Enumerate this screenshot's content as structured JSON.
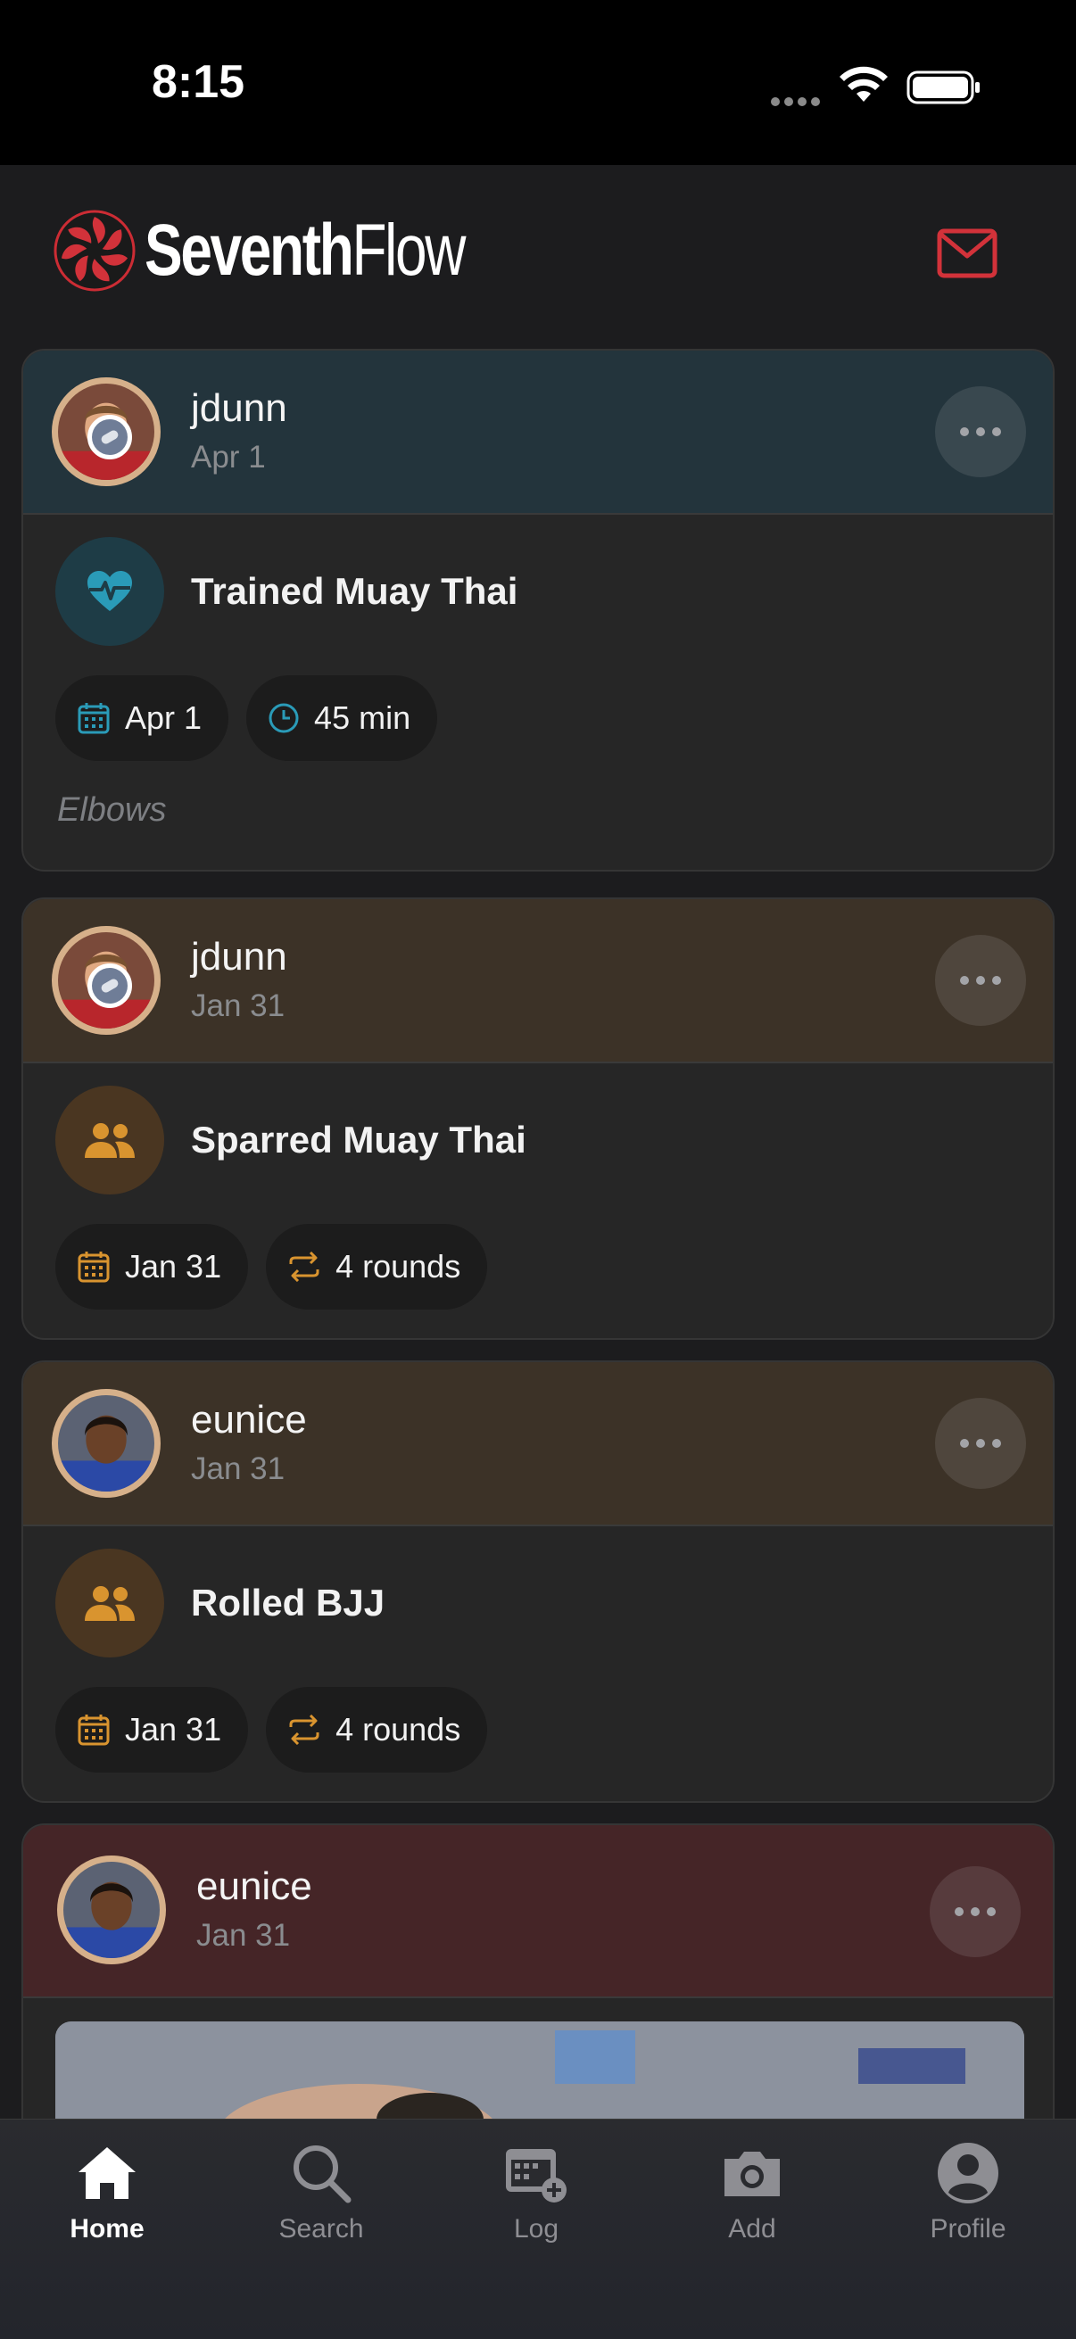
{
  "status_bar": {
    "time": "8:15"
  },
  "header": {
    "logo_bold": "Seventh",
    "logo_light": "Flow",
    "accent_color": "#d2323a"
  },
  "feed": [
    {
      "theme": "blue",
      "user": "jdunn",
      "date": "Apr 1",
      "has_badge": true,
      "activity_icon": "heart-pulse-icon",
      "activity": "Trained Muay Thai",
      "chips": [
        {
          "icon": "calendar-icon",
          "label": "Apr 1"
        },
        {
          "icon": "clock-icon",
          "label": "45 min"
        }
      ],
      "note": "Elbows"
    },
    {
      "theme": "brown",
      "user": "jdunn",
      "date": "Jan 31",
      "has_badge": true,
      "activity_icon": "people-icon",
      "activity": "Sparred Muay Thai",
      "chips": [
        {
          "icon": "calendar-icon",
          "label": "Jan 31"
        },
        {
          "icon": "repeat-icon",
          "label": "4 rounds"
        }
      ]
    },
    {
      "theme": "brown",
      "user": "eunice",
      "date": "Jan 31",
      "has_badge": false,
      "activity_icon": "people-icon",
      "activity": "Rolled BJJ",
      "chips": [
        {
          "icon": "calendar-icon",
          "label": "Jan 31"
        },
        {
          "icon": "repeat-icon",
          "label": "4 rounds"
        }
      ]
    },
    {
      "theme": "red",
      "user": "eunice",
      "date": "Jan 31",
      "has_badge": false
    }
  ],
  "tabs": [
    {
      "icon": "home-icon",
      "label": "Home",
      "active": true
    },
    {
      "icon": "search-icon",
      "label": "Search",
      "active": false
    },
    {
      "icon": "log-icon",
      "label": "Log",
      "active": false
    },
    {
      "icon": "camera-icon",
      "label": "Add",
      "active": false
    },
    {
      "icon": "profile-icon",
      "label": "Profile",
      "active": false
    }
  ],
  "colors": {
    "blue_header": "#23343c",
    "brown_header": "#3c3227",
    "red_header": "#452527",
    "teal_icon": "#2a9bb8",
    "orange_icon": "#d9942f"
  }
}
